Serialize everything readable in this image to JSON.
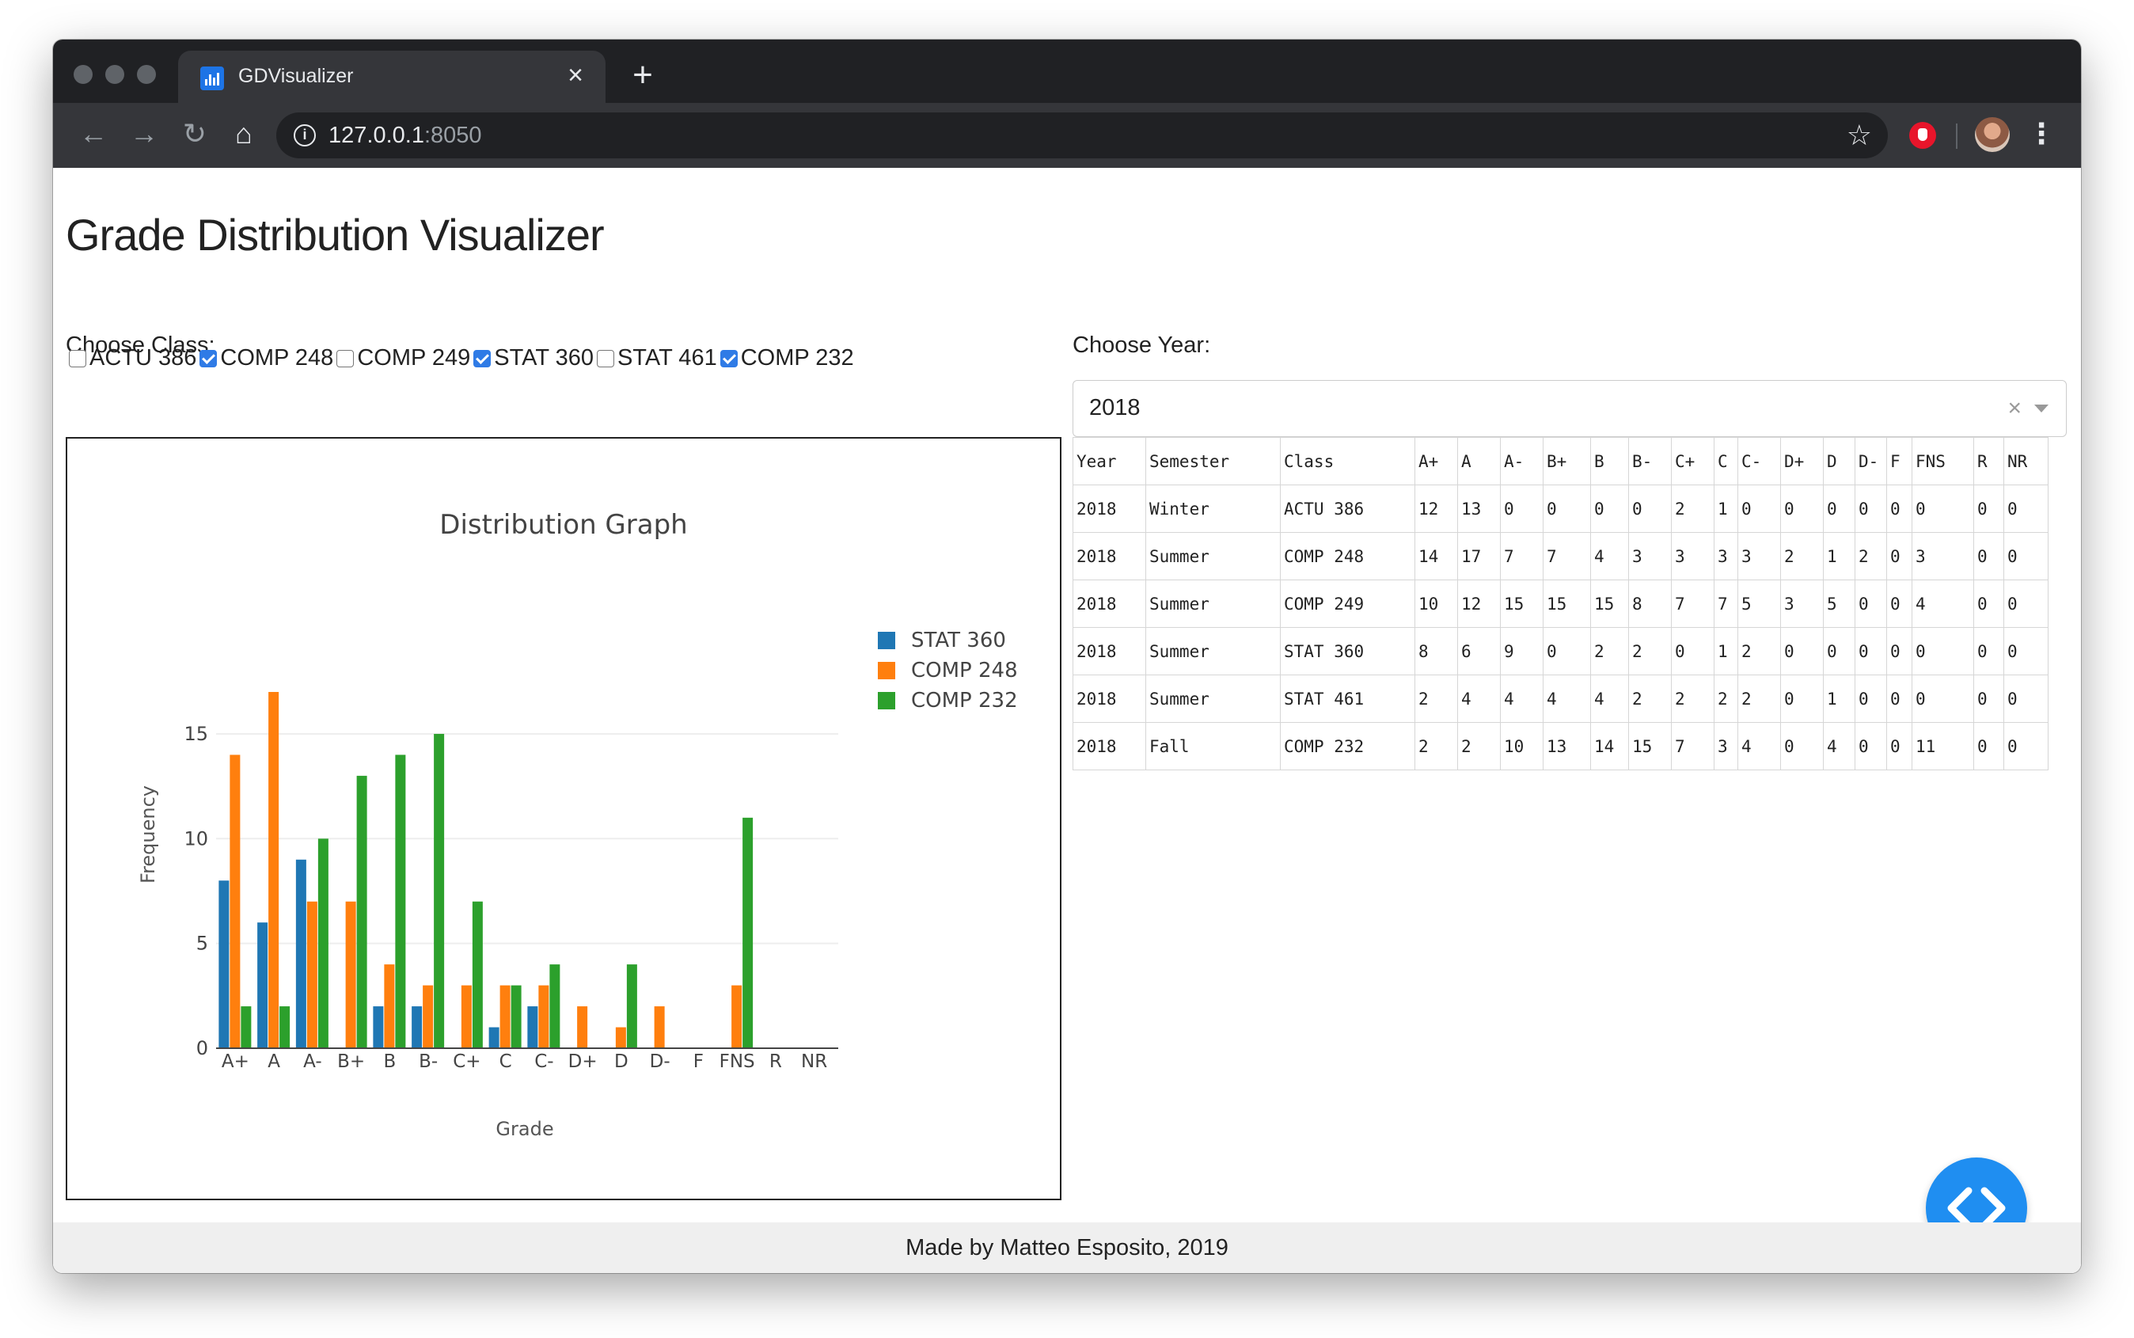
{
  "browser": {
    "tab_title": "GDVisualizer",
    "url_host": "127.0.0.1",
    "url_port": ":8050"
  },
  "page": {
    "title": "Grade Distribution Visualizer",
    "choose_class_label": "Choose Class:",
    "choose_year_label": "Choose Year:",
    "footer": "Made by Matteo Esposito, 2019"
  },
  "classes": [
    {
      "label": "ACTU 386",
      "checked": false
    },
    {
      "label": "COMP 248",
      "checked": true
    },
    {
      "label": "COMP 249",
      "checked": false
    },
    {
      "label": "STAT 360",
      "checked": true
    },
    {
      "label": "STAT 461",
      "checked": false
    },
    {
      "label": "COMP 232",
      "checked": true
    }
  ],
  "year_dropdown": {
    "value": "2018"
  },
  "table": {
    "headers": [
      "Year",
      "Semester",
      "Class",
      "A+",
      "A",
      "A-",
      "B+",
      "B",
      "B-",
      "C+",
      "C",
      "C-",
      "D+",
      "D",
      "D-",
      "F",
      "FNS",
      "R",
      "NR"
    ],
    "rows": [
      [
        "2018",
        "Winter",
        "ACTU 386",
        "12",
        "13",
        "0",
        "0",
        "0",
        "0",
        "2",
        "1",
        "0",
        "0",
        "0",
        "0",
        "0",
        "0",
        "0",
        "0"
      ],
      [
        "2018",
        "Summer",
        "COMP 248",
        "14",
        "17",
        "7",
        "7",
        "4",
        "3",
        "3",
        "3",
        "3",
        "2",
        "1",
        "2",
        "0",
        "3",
        "0",
        "0"
      ],
      [
        "2018",
        "Summer",
        "COMP 249",
        "10",
        "12",
        "15",
        "15",
        "15",
        "8",
        "7",
        "7",
        "5",
        "3",
        "5",
        "0",
        "0",
        "4",
        "0",
        "0"
      ],
      [
        "2018",
        "Summer",
        "STAT 360",
        "8",
        "6",
        "9",
        "0",
        "2",
        "2",
        "0",
        "1",
        "2",
        "0",
        "0",
        "0",
        "0",
        "0",
        "0",
        "0"
      ],
      [
        "2018",
        "Summer",
        "STAT 461",
        "2",
        "4",
        "4",
        "4",
        "4",
        "2",
        "2",
        "2",
        "2",
        "0",
        "1",
        "0",
        "0",
        "0",
        "0",
        "0"
      ],
      [
        "2018",
        "Fall",
        "COMP 232",
        "2",
        "2",
        "10",
        "13",
        "14",
        "15",
        "7",
        "3",
        "4",
        "0",
        "4",
        "0",
        "0",
        "11",
        "0",
        "0"
      ]
    ]
  },
  "chart_data": {
    "type": "bar",
    "title": "Distribution Graph",
    "xlabel": "Grade",
    "ylabel": "Frequency",
    "categories": [
      "A+",
      "A",
      "A-",
      "B+",
      "B",
      "B-",
      "C+",
      "C",
      "C-",
      "D+",
      "D",
      "D-",
      "F",
      "FNS",
      "R",
      "NR"
    ],
    "ylim": [
      0,
      17
    ],
    "yticks": [
      0,
      5,
      10,
      15
    ],
    "legend_position": "right",
    "series": [
      {
        "name": "STAT 360",
        "color": "#1f77b4",
        "values": [
          8,
          6,
          9,
          0,
          2,
          2,
          0,
          1,
          2,
          0,
          0,
          0,
          0,
          0,
          0,
          0
        ]
      },
      {
        "name": "COMP 248",
        "color": "#ff7f0e",
        "values": [
          14,
          17,
          7,
          7,
          4,
          3,
          3,
          3,
          3,
          2,
          1,
          2,
          0,
          3,
          0,
          0
        ]
      },
      {
        "name": "COMP 232",
        "color": "#2ca02c",
        "values": [
          2,
          2,
          10,
          13,
          14,
          15,
          7,
          3,
          4,
          0,
          4,
          0,
          0,
          11,
          0,
          0
        ]
      }
    ]
  }
}
